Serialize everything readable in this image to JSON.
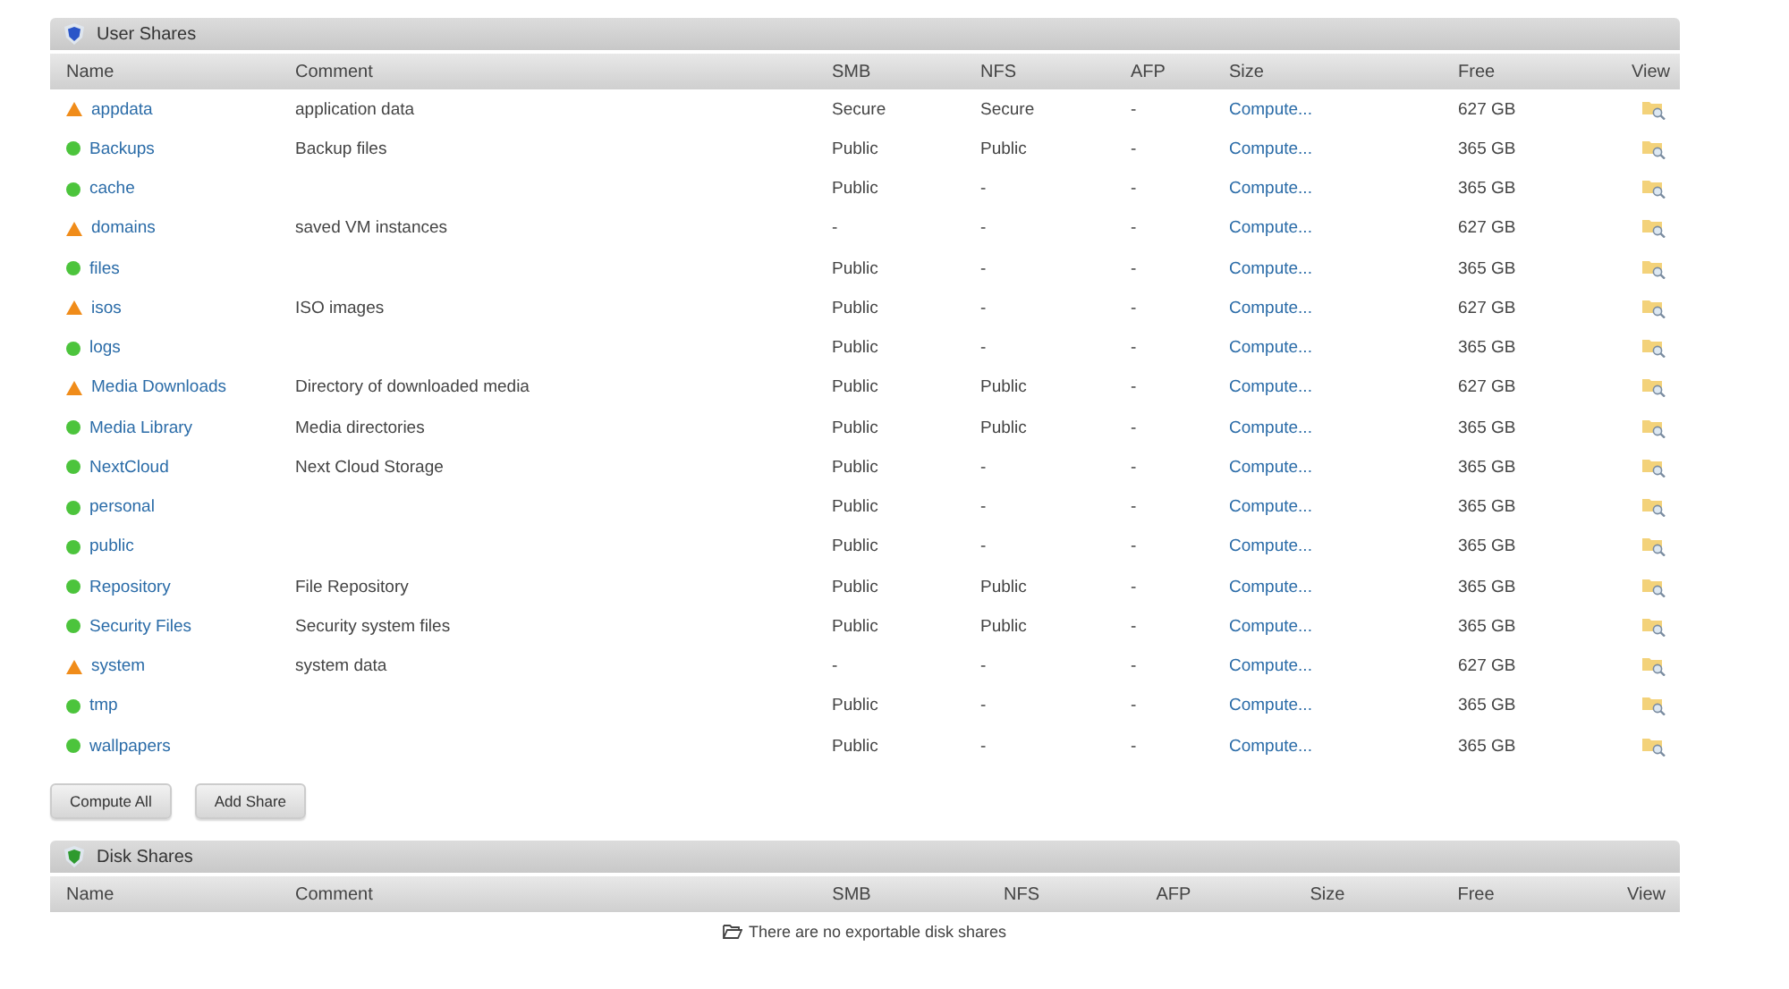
{
  "user_shares": {
    "title": "User Shares",
    "columns": [
      "Name",
      "Comment",
      "SMB",
      "NFS",
      "AFP",
      "Size",
      "Free",
      "View"
    ],
    "rows": [
      {
        "kind": "warning",
        "name": "appdata",
        "comment": "application data",
        "smb": "Secure",
        "nfs": "Secure",
        "afp": "-",
        "size": "Compute...",
        "free": "627 GB"
      },
      {
        "kind": "ok",
        "name": "Backups",
        "comment": "Backup files",
        "smb": "Public",
        "nfs": "Public",
        "afp": "-",
        "size": "Compute...",
        "free": "365 GB"
      },
      {
        "kind": "ok",
        "name": "cache",
        "smb": "Public",
        "nfs": "-",
        "afp": "-",
        "size": "Compute...",
        "free": "365 GB"
      },
      {
        "kind": "warning",
        "name": "domains",
        "comment": "saved VM instances",
        "smb": "-",
        "nfs": "-",
        "afp": "-",
        "size": "Compute...",
        "free": "627 GB"
      },
      {
        "kind": "ok",
        "name": "files",
        "smb": "Public",
        "nfs": "-",
        "afp": "-",
        "size": "Compute...",
        "free": "365 GB"
      },
      {
        "kind": "warning",
        "name": "isos",
        "comment": "ISO images",
        "smb": "Public",
        "nfs": "-",
        "afp": "-",
        "size": "Compute...",
        "free": "627 GB"
      },
      {
        "kind": "ok",
        "name": "logs",
        "smb": "Public",
        "nfs": "-",
        "afp": "-",
        "size": "Compute...",
        "free": "365 GB"
      },
      {
        "kind": "warning",
        "name": "Media Downloads",
        "comment": "Directory of downloaded media",
        "smb": "Public",
        "nfs": "Public",
        "afp": "-",
        "size": "Compute...",
        "free": "627 GB"
      },
      {
        "kind": "ok",
        "name": "Media Library",
        "comment": "Media directories",
        "smb": "Public",
        "nfs": "Public",
        "afp": "-",
        "size": "Compute...",
        "free": "365 GB"
      },
      {
        "kind": "ok",
        "name": "NextCloud",
        "comment": "Next Cloud Storage",
        "smb": "Public",
        "nfs": "-",
        "afp": "-",
        "size": "Compute...",
        "free": "365 GB"
      },
      {
        "kind": "ok",
        "name": "personal",
        "smb": "Public",
        "nfs": "-",
        "afp": "-",
        "size": "Compute...",
        "free": "365 GB"
      },
      {
        "kind": "ok",
        "name": "public",
        "smb": "Public",
        "nfs": "-",
        "afp": "-",
        "size": "Compute...",
        "free": "365 GB"
      },
      {
        "kind": "ok",
        "name": "Repository",
        "comment": "File Repository",
        "smb": "Public",
        "nfs": "Public",
        "afp": "-",
        "size": "Compute...",
        "free": "365 GB"
      },
      {
        "kind": "ok",
        "name": "Security Files",
        "comment": "Security system files",
        "smb": "Public",
        "nfs": "Public",
        "afp": "-",
        "size": "Compute...",
        "free": "365 GB"
      },
      {
        "kind": "warning",
        "name": "system",
        "comment": "system data",
        "smb": "-",
        "nfs": "-",
        "afp": "-",
        "size": "Compute...",
        "free": "627 GB"
      },
      {
        "kind": "ok",
        "name": "tmp",
        "smb": "Public",
        "nfs": "-",
        "afp": "-",
        "size": "Compute...",
        "free": "365 GB"
      },
      {
        "kind": "ok",
        "name": "wallpapers",
        "smb": "Public",
        "nfs": "-",
        "afp": "-",
        "size": "Compute...",
        "free": "365 GB"
      }
    ],
    "buttons": [
      "Compute All",
      "Add Share"
    ]
  },
  "disk_shares": {
    "title": "Disk Shares",
    "columns": [
      "Name",
      "Comment",
      "SMB",
      "NFS",
      "AFP",
      "Size",
      "Free",
      "View"
    ],
    "empty_message": "There are no exportable disk shares"
  }
}
